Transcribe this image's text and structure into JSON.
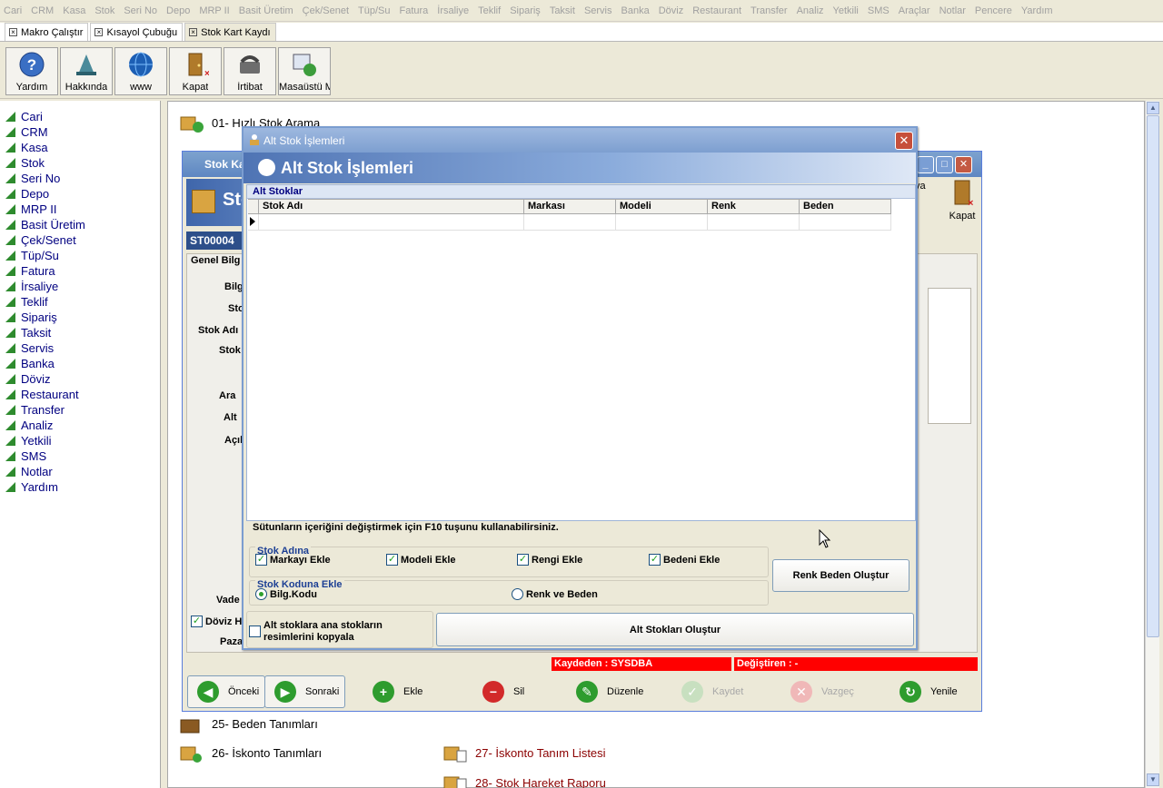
{
  "menubar": [
    "Cari",
    "CRM",
    "Kasa",
    "Stok",
    "Seri No",
    "Depo",
    "MRP II",
    "Basit Üretim",
    "Çek/Senet",
    "Tüp/Su",
    "Fatura",
    "İrsaliye",
    "Teklif",
    "Sipariş",
    "Taksit",
    "Servis",
    "Banka",
    "Döviz",
    "Restaurant",
    "Transfer",
    "Analiz",
    "Yetkili",
    "SMS",
    "Araçlar",
    "Notlar",
    "Pencere",
    "Yardım"
  ],
  "tabs": [
    "Makro Çalıştır",
    "Kısayol Çubuğu",
    "Stok Kart Kaydı"
  ],
  "toolbar": [
    "Yardım",
    "Hakkında",
    "www",
    "Kapat",
    "İrtibat",
    "Masaüstü M"
  ],
  "leftnav": [
    "Cari",
    "CRM",
    "Kasa",
    "Stok",
    "Seri No",
    "Depo",
    "MRP II",
    "Basit Üretim",
    "Çek/Senet",
    "Tüp/Su",
    "Fatura",
    "İrsaliye",
    "Teklif",
    "Sipariş",
    "Taksit",
    "Servis",
    "Banka",
    "Döviz",
    "Restaurant",
    "Transfer",
    "Analiz",
    "Yetkili",
    "SMS",
    "Notlar",
    "Yardım"
  ],
  "reports": {
    "r01": "01- Hızlı Stok Arama",
    "r25": "25- Beden Tanımları",
    "r26": "26- İskonto Tanımları",
    "r27": "27- İskonto Tanım Listesi",
    "r28": "28- Stok Hareket Raporu"
  },
  "stokwin": {
    "title": "Stok Ka",
    "header_fragment": "Sto",
    "code": "ST00004",
    "kapat": "Kapat",
    "kaydet_fragment": "va",
    "labels": [
      "Genel Bilg",
      "Bilg",
      "Sto",
      "Stok Adı",
      "Stok",
      "Ara",
      "Alt",
      "Açıl",
      "Vade",
      "Döviz H",
      "Pazar"
    ],
    "kaydeden": "Kaydeden : SYSDBA",
    "degistiren": "Değiştiren :  -",
    "buttons": {
      "onceki": "Önceki",
      "sonraki": "Sonraki",
      "ekle": "Ekle",
      "sil": "Sil",
      "duzenle": "Düzenle",
      "kaydet": "Kaydet",
      "vazgec": "Vazgeç",
      "yenile": "Yenile"
    }
  },
  "dialog": {
    "title": "Alt Stok İşlemleri",
    "header": "Alt Stok İşlemleri",
    "grid_caption": "Alt Stoklar",
    "columns": [
      "Stok Adı",
      "Markası",
      "Modeli",
      "Renk",
      "Beden"
    ],
    "note": "Sütunların içeriğini değiştirmek için F10 tuşunu kullanabilirsiniz.",
    "stok_adina": {
      "caption": "Stok Adına",
      "markayi": "Markayı Ekle",
      "modeli": "Modeli Ekle",
      "rengi": "Rengi Ekle",
      "bedeni": "Bedeni Ekle"
    },
    "stok_koduna": {
      "caption": "Stok Koduna Ekle",
      "bilg_kodu": "Bilg.Kodu",
      "renk_beden": "Renk ve Beden"
    },
    "renk_beden_btn": "Renk Beden Oluştur",
    "resim_line1": "Alt stoklara ana stokların",
    "resim_line2": "resimlerini kopyala",
    "alt_stok_btn": "Alt Stokları Oluştur"
  }
}
